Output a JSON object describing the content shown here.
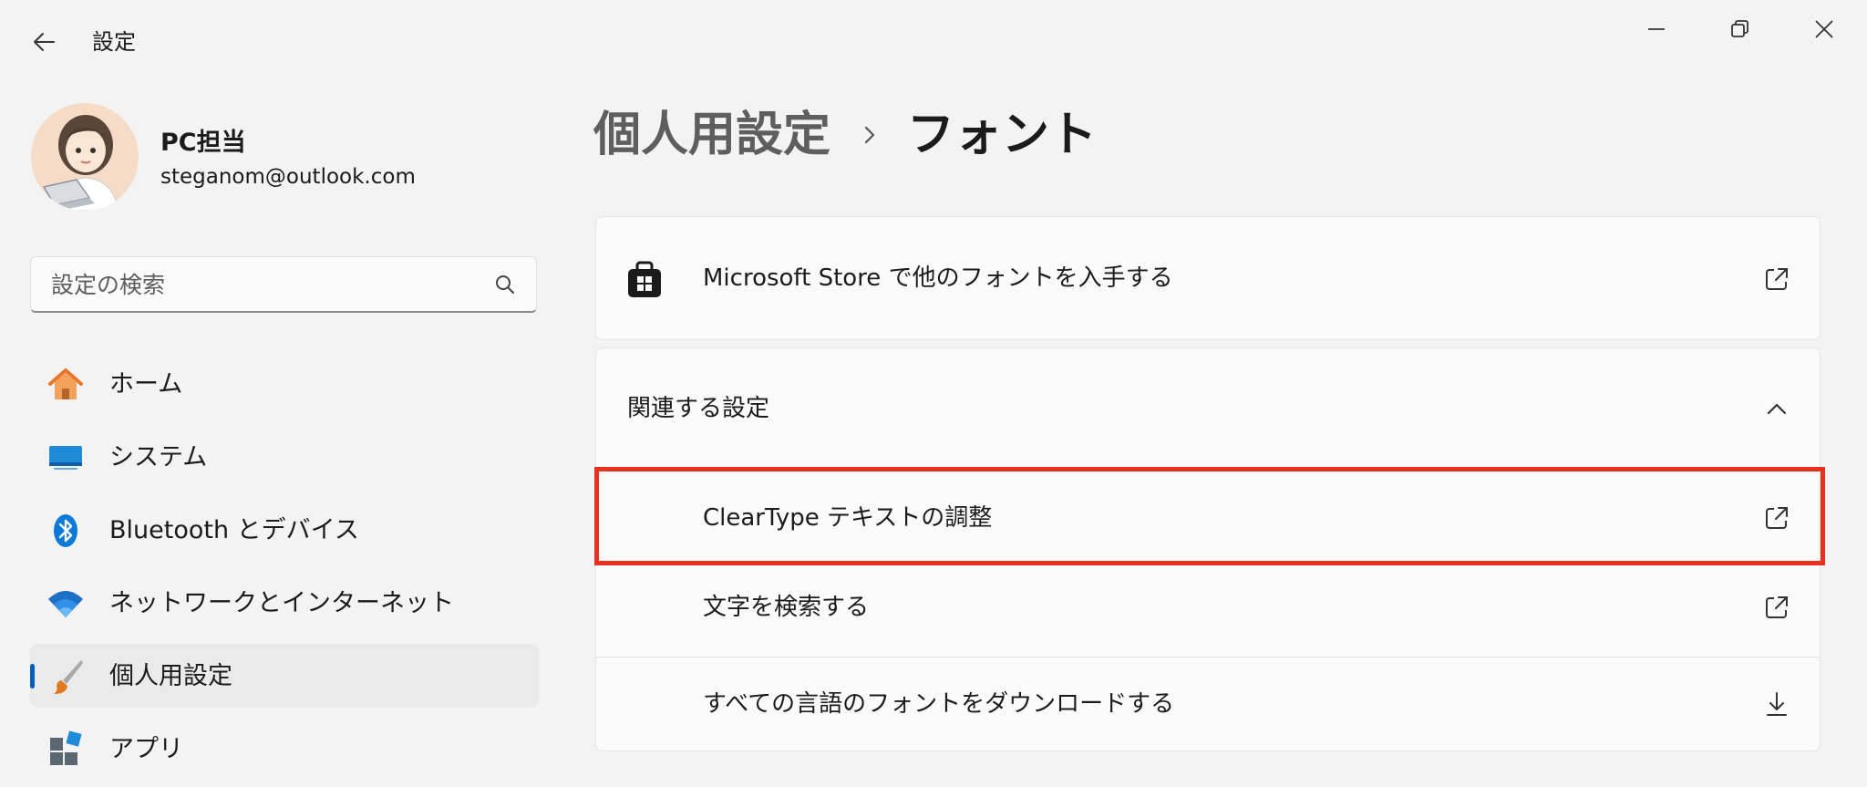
{
  "app": {
    "title": "設定"
  },
  "profile": {
    "name": "PC担当",
    "email": "steganom@outlook.com"
  },
  "search": {
    "placeholder": "設定の検索",
    "value": ""
  },
  "nav": {
    "items": [
      {
        "label": "ホーム",
        "icon": "home-icon"
      },
      {
        "label": "システム",
        "icon": "system-icon"
      },
      {
        "label": "Bluetooth とデバイス",
        "icon": "bluetooth-icon"
      },
      {
        "label": "ネットワークとインターネット",
        "icon": "wifi-icon"
      },
      {
        "label": "個人用設定",
        "icon": "brush-icon",
        "selected": true
      },
      {
        "label": "アプリ",
        "icon": "apps-icon"
      }
    ]
  },
  "header": {
    "parent": "個人用設定",
    "current": "フォント"
  },
  "store_card": {
    "label": "Microsoft Store で他のフォントを入手する"
  },
  "related": {
    "title": "関連する設定",
    "items": [
      {
        "label": "ClearType テキストの調整",
        "icon": "external-link-icon"
      },
      {
        "label": "文字を検索する",
        "icon": "external-link-icon"
      },
      {
        "label": "すべての言語のフォントをダウンロードする",
        "icon": "download-icon"
      }
    ]
  },
  "colors": {
    "accent": "#005fb8",
    "highlight": "#e8321f",
    "background": "#f3f3f3",
    "card": "#fbfbfb"
  }
}
